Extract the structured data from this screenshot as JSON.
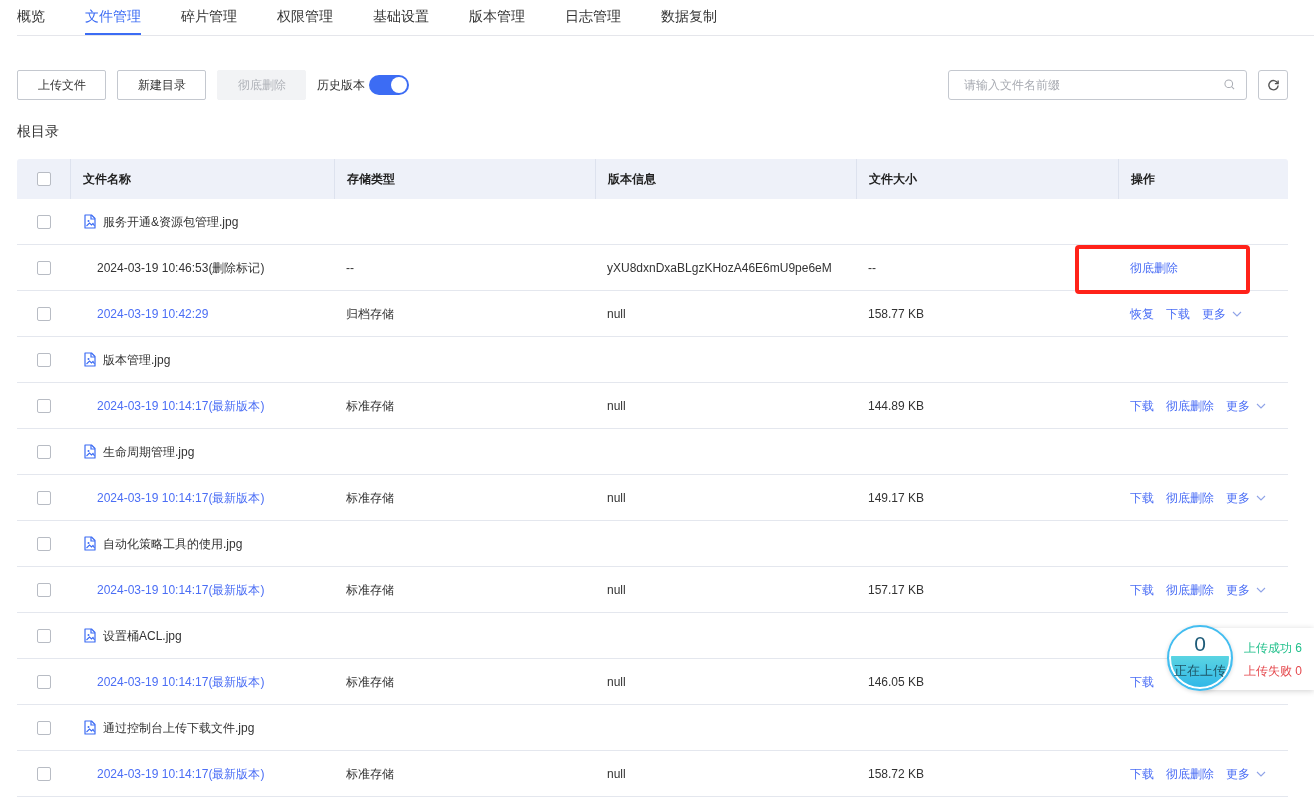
{
  "tabs": [
    {
      "label": "概览",
      "selected": false
    },
    {
      "label": "文件管理",
      "selected": true
    },
    {
      "label": "碎片管理",
      "selected": false
    },
    {
      "label": "权限管理",
      "selected": false
    },
    {
      "label": "基础设置",
      "selected": false
    },
    {
      "label": "版本管理",
      "selected": false
    },
    {
      "label": "日志管理",
      "selected": false
    },
    {
      "label": "数据复制",
      "selected": false
    }
  ],
  "toolbar": {
    "buttons": [
      {
        "label": "上传文件",
        "disabled": false
      },
      {
        "label": "新建目录",
        "disabled": false
      },
      {
        "label": "彻底删除",
        "disabled": true
      }
    ],
    "history_toggle": {
      "label": "历史版本",
      "on": true
    },
    "search": {
      "placeholder": "请输入文件名前缀"
    }
  },
  "breadcrumb": "根目录",
  "table": {
    "header_checked": false,
    "columns": [
      "文件名称",
      "存储类型",
      "版本信息",
      "文件大小",
      "操作"
    ],
    "rows": [
      {
        "kind": "file",
        "checked": false,
        "name": "服务开通&资源包管理.jpg"
      },
      {
        "kind": "version",
        "checked": false,
        "time": "2024-03-19 10:46:53(删除标记)",
        "deleted": true,
        "storage": "--",
        "version_info": "yXU8dxnDxaBLgzKHozA46E6mU9pe6eM",
        "size": "--",
        "highlighted": true,
        "actions": [
          {
            "label": "彻底删除",
            "kind": "link"
          }
        ]
      },
      {
        "kind": "version",
        "checked": false,
        "time": "2024-03-19 10:42:29",
        "deleted": false,
        "storage": "归档存储",
        "version_info": "null",
        "size": "158.77 KB",
        "highlighted": false,
        "actions": [
          {
            "label": "恢复",
            "kind": "link"
          },
          {
            "label": "下载",
            "kind": "link"
          },
          {
            "label": "更多",
            "kind": "dropdown"
          }
        ]
      },
      {
        "kind": "file",
        "checked": false,
        "name": "版本管理.jpg"
      },
      {
        "kind": "version",
        "checked": false,
        "time": "2024-03-19 10:14:17(最新版本)",
        "deleted": false,
        "storage": "标准存储",
        "version_info": "null",
        "size": "144.89 KB",
        "highlighted": false,
        "actions": [
          {
            "label": "下载",
            "kind": "link"
          },
          {
            "label": "彻底删除",
            "kind": "link"
          },
          {
            "label": "更多",
            "kind": "dropdown"
          }
        ]
      },
      {
        "kind": "file",
        "checked": false,
        "name": "生命周期管理.jpg"
      },
      {
        "kind": "version",
        "checked": false,
        "time": "2024-03-19 10:14:17(最新版本)",
        "deleted": false,
        "storage": "标准存储",
        "version_info": "null",
        "size": "149.17 KB",
        "highlighted": false,
        "actions": [
          {
            "label": "下载",
            "kind": "link"
          },
          {
            "label": "彻底删除",
            "kind": "link"
          },
          {
            "label": "更多",
            "kind": "dropdown"
          }
        ]
      },
      {
        "kind": "file",
        "checked": false,
        "name": "自动化策略工具的使用.jpg"
      },
      {
        "kind": "version",
        "checked": false,
        "time": "2024-03-19 10:14:17(最新版本)",
        "deleted": false,
        "storage": "标准存储",
        "version_info": "null",
        "size": "157.17 KB",
        "highlighted": false,
        "actions": [
          {
            "label": "下载",
            "kind": "link"
          },
          {
            "label": "彻底删除",
            "kind": "link"
          },
          {
            "label": "更多",
            "kind": "dropdown"
          }
        ]
      },
      {
        "kind": "file",
        "checked": false,
        "name": "设置桶ACL.jpg"
      },
      {
        "kind": "version",
        "checked": false,
        "time": "2024-03-19 10:14:17(最新版本)",
        "deleted": false,
        "storage": "标准存储",
        "version_info": "null",
        "size": "146.05 KB",
        "highlighted": false,
        "actions": [
          {
            "label": "下载",
            "kind": "link"
          }
        ]
      },
      {
        "kind": "file",
        "checked": false,
        "name": "通过控制台上传下载文件.jpg"
      },
      {
        "kind": "version",
        "checked": false,
        "time": "2024-03-19 10:14:17(最新版本)",
        "deleted": false,
        "storage": "标准存储",
        "version_info": "null",
        "size": "158.72 KB",
        "highlighted": false,
        "actions": [
          {
            "label": "下载",
            "kind": "link"
          },
          {
            "label": "彻底删除",
            "kind": "link"
          },
          {
            "label": "更多",
            "kind": "dropdown"
          }
        ]
      }
    ]
  },
  "upload_status": {
    "count": "0",
    "label": "正在上传",
    "success": "上传成功 6",
    "failed": "上传失败 0"
  }
}
